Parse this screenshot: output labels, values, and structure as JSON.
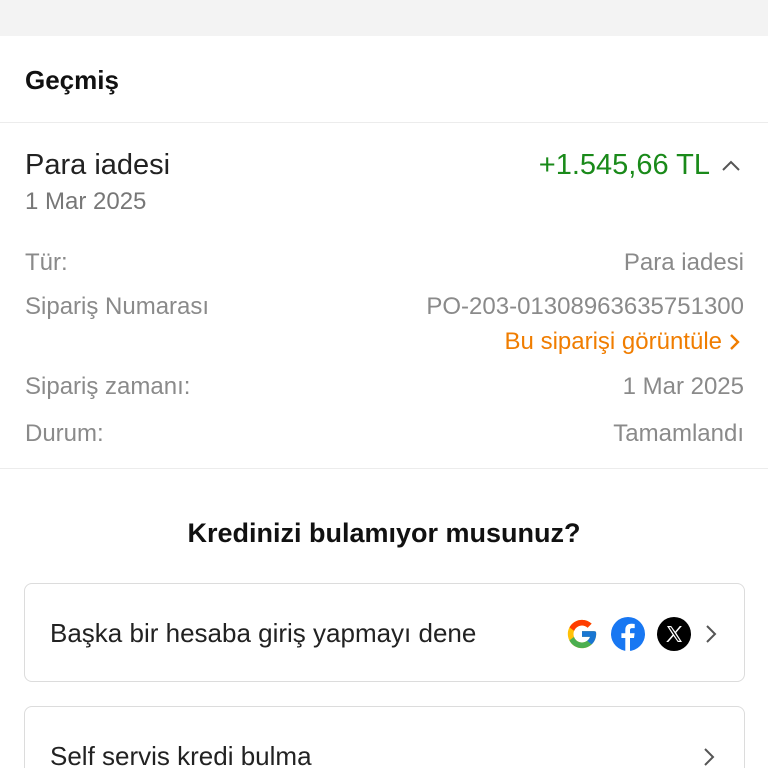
{
  "header": {
    "title": "Geçmiş"
  },
  "transaction": {
    "title": "Para iadesi",
    "date": "1 Mar 2025",
    "amount": "+1.545,66 TL",
    "amount_color": "#1a8a1a",
    "expand_icon": "chevron-up-icon",
    "details": {
      "type_label": "Tür:",
      "type_value": "Para iadesi",
      "order_label": "Sipariş Numarası",
      "order_value": "PO-203-01308963635751300",
      "view_order_link": "Bu siparişi görüntüle",
      "time_label": "Sipariş zamanı:",
      "time_value": "1 Mar 2025",
      "status_label": "Durum:",
      "status_value": "Tamamlandı"
    }
  },
  "help": {
    "title": "Kredinizi bulamıyor musunuz?",
    "options": [
      {
        "label": "Başka bir hesaba giriş yapmayı dene",
        "icons": [
          "google-icon",
          "facebook-icon",
          "x-icon"
        ]
      },
      {
        "label": "Self servis kredi bulma"
      }
    ]
  },
  "colors": {
    "accent_orange": "#f07d00",
    "positive_green": "#1a8a1a"
  }
}
